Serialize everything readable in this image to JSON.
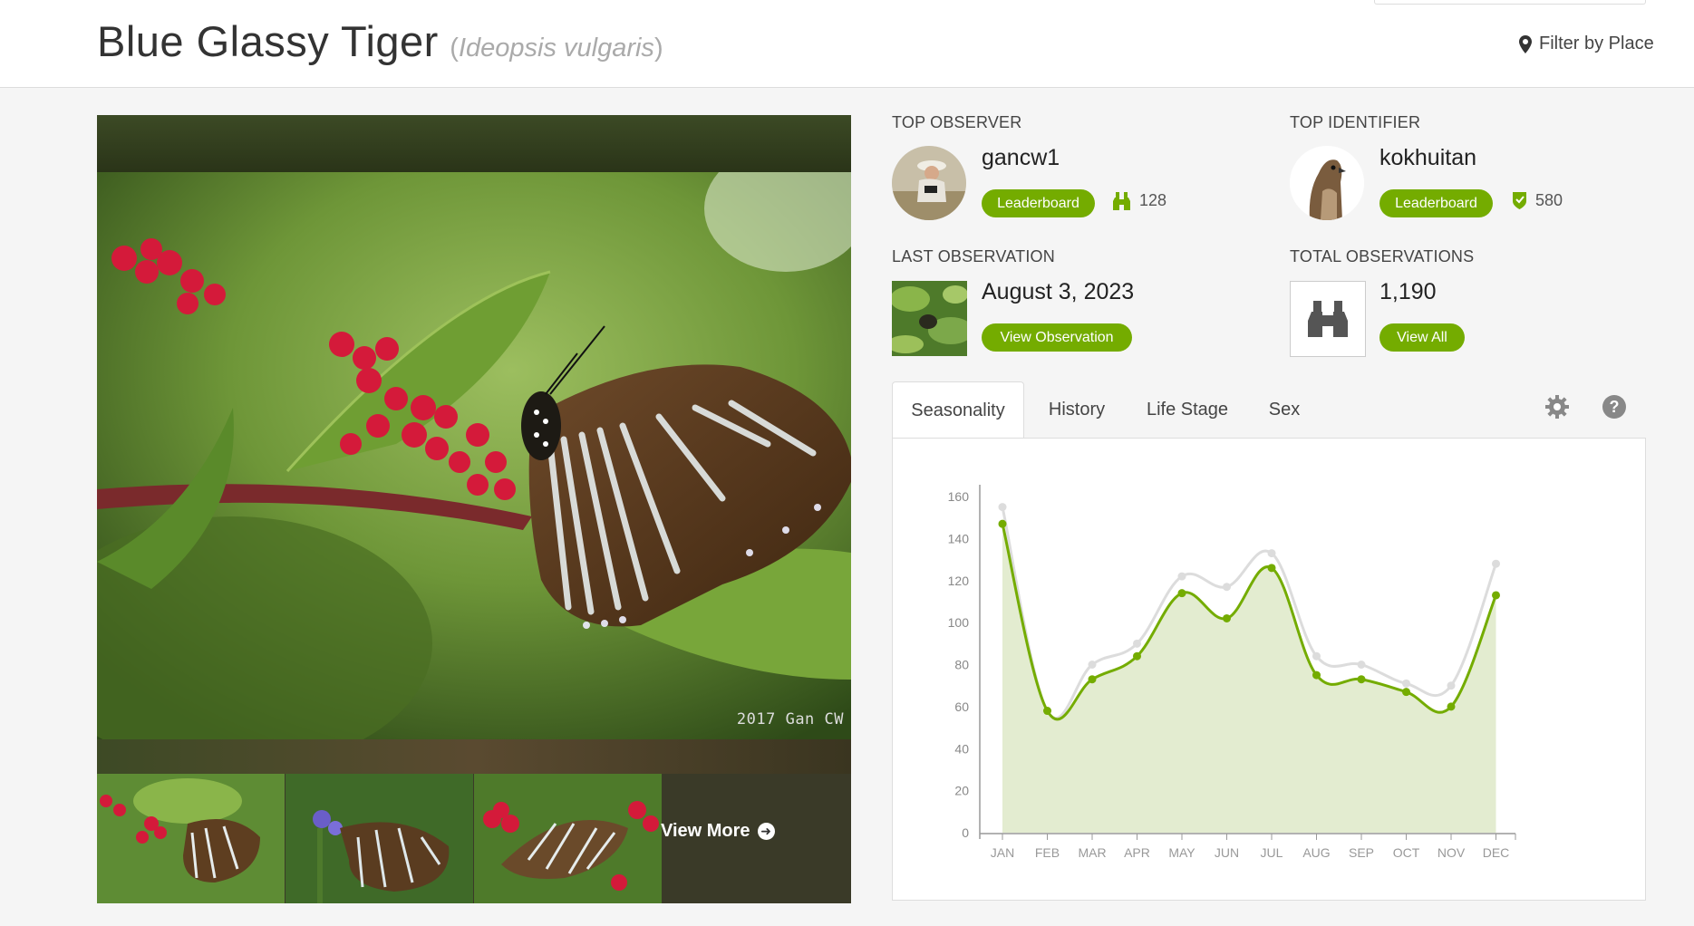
{
  "header": {
    "common_name": "Blue Glassy Tiger",
    "scientific_name": "Ideopsis vulgaris",
    "filter_label": "Filter by Place"
  },
  "photos": {
    "credit": "2017 Gan CW",
    "view_more_label": "View More"
  },
  "top_observer": {
    "label": "TOP OBSERVER",
    "name": "gancw1",
    "leaderboard_label": "Leaderboard",
    "count": "128",
    "icon": "binoculars-icon"
  },
  "top_identifier": {
    "label": "TOP IDENTIFIER",
    "name": "kokhuitan",
    "leaderboard_label": "Leaderboard",
    "count": "580",
    "icon": "shield-icon"
  },
  "last_observation": {
    "label": "LAST OBSERVATION",
    "date": "August 3, 2023",
    "button_label": "View Observation"
  },
  "total_observations": {
    "label": "TOTAL OBSERVATIONS",
    "count": "1,190",
    "button_label": "View All"
  },
  "tabs": [
    {
      "label": "Seasonality",
      "active": true
    },
    {
      "label": "History",
      "active": false
    },
    {
      "label": "Life Stage",
      "active": false
    },
    {
      "label": "Sex",
      "active": false
    }
  ],
  "tab_icons": [
    "gear-icon",
    "help-icon"
  ],
  "colors": {
    "accent": "#74ac00",
    "accent_fill": "#e3ecd0",
    "secondary_line": "#dcdcdc"
  },
  "chart_data": {
    "type": "area",
    "categories": [
      "JAN",
      "FEB",
      "MAR",
      "APR",
      "MAY",
      "JUN",
      "JUL",
      "AUG",
      "SEP",
      "OCT",
      "NOV",
      "DEC"
    ],
    "series": [
      {
        "values": [
          147,
          58,
          73,
          84,
          114,
          102,
          126,
          75,
          73,
          67,
          60,
          113
        ],
        "color": "#74ac00",
        "filled": true
      },
      {
        "values": [
          155,
          58,
          80,
          90,
          122,
          117,
          133,
          84,
          80,
          71,
          70,
          128
        ],
        "color": "#dcdcdc",
        "filled": false
      }
    ],
    "ylim": [
      0,
      160
    ],
    "yticks": [
      0,
      20,
      40,
      60,
      80,
      100,
      120,
      140,
      160
    ],
    "grid": false
  }
}
